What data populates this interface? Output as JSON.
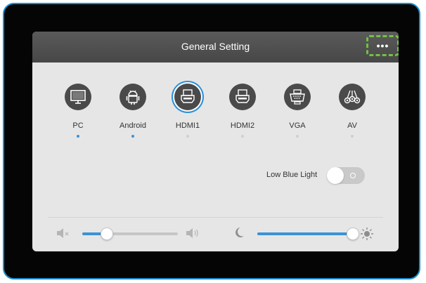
{
  "header": {
    "title": "General Setting",
    "more_button": "•••",
    "more_icon": "more-dots-icon"
  },
  "sources": [
    {
      "label": "PC",
      "icon": "monitor-icon",
      "selected": true
    },
    {
      "label": "Android",
      "icon": "android-icon",
      "selected": true
    },
    {
      "label": "HDMI1",
      "icon": "hdmi-icon",
      "selected": false,
      "focused": true
    },
    {
      "label": "HDMI2",
      "icon": "hdmi-icon",
      "selected": false
    },
    {
      "label": "VGA",
      "icon": "vga-icon",
      "selected": false
    },
    {
      "label": "AV",
      "icon": "av-icon",
      "selected": false
    }
  ],
  "low_blue_light": {
    "label": "Low Blue Light",
    "enabled": false
  },
  "volume": {
    "level": 0.26,
    "icons": [
      "volume-mute-icon",
      "volume-up-icon"
    ]
  },
  "brightness": {
    "level": 1.0,
    "icons": [
      "moon-icon",
      "sun-icon"
    ]
  },
  "colors": {
    "accent": "#3c92d6",
    "focus_outline": "#74c043",
    "frame": "#1a8fd0"
  }
}
